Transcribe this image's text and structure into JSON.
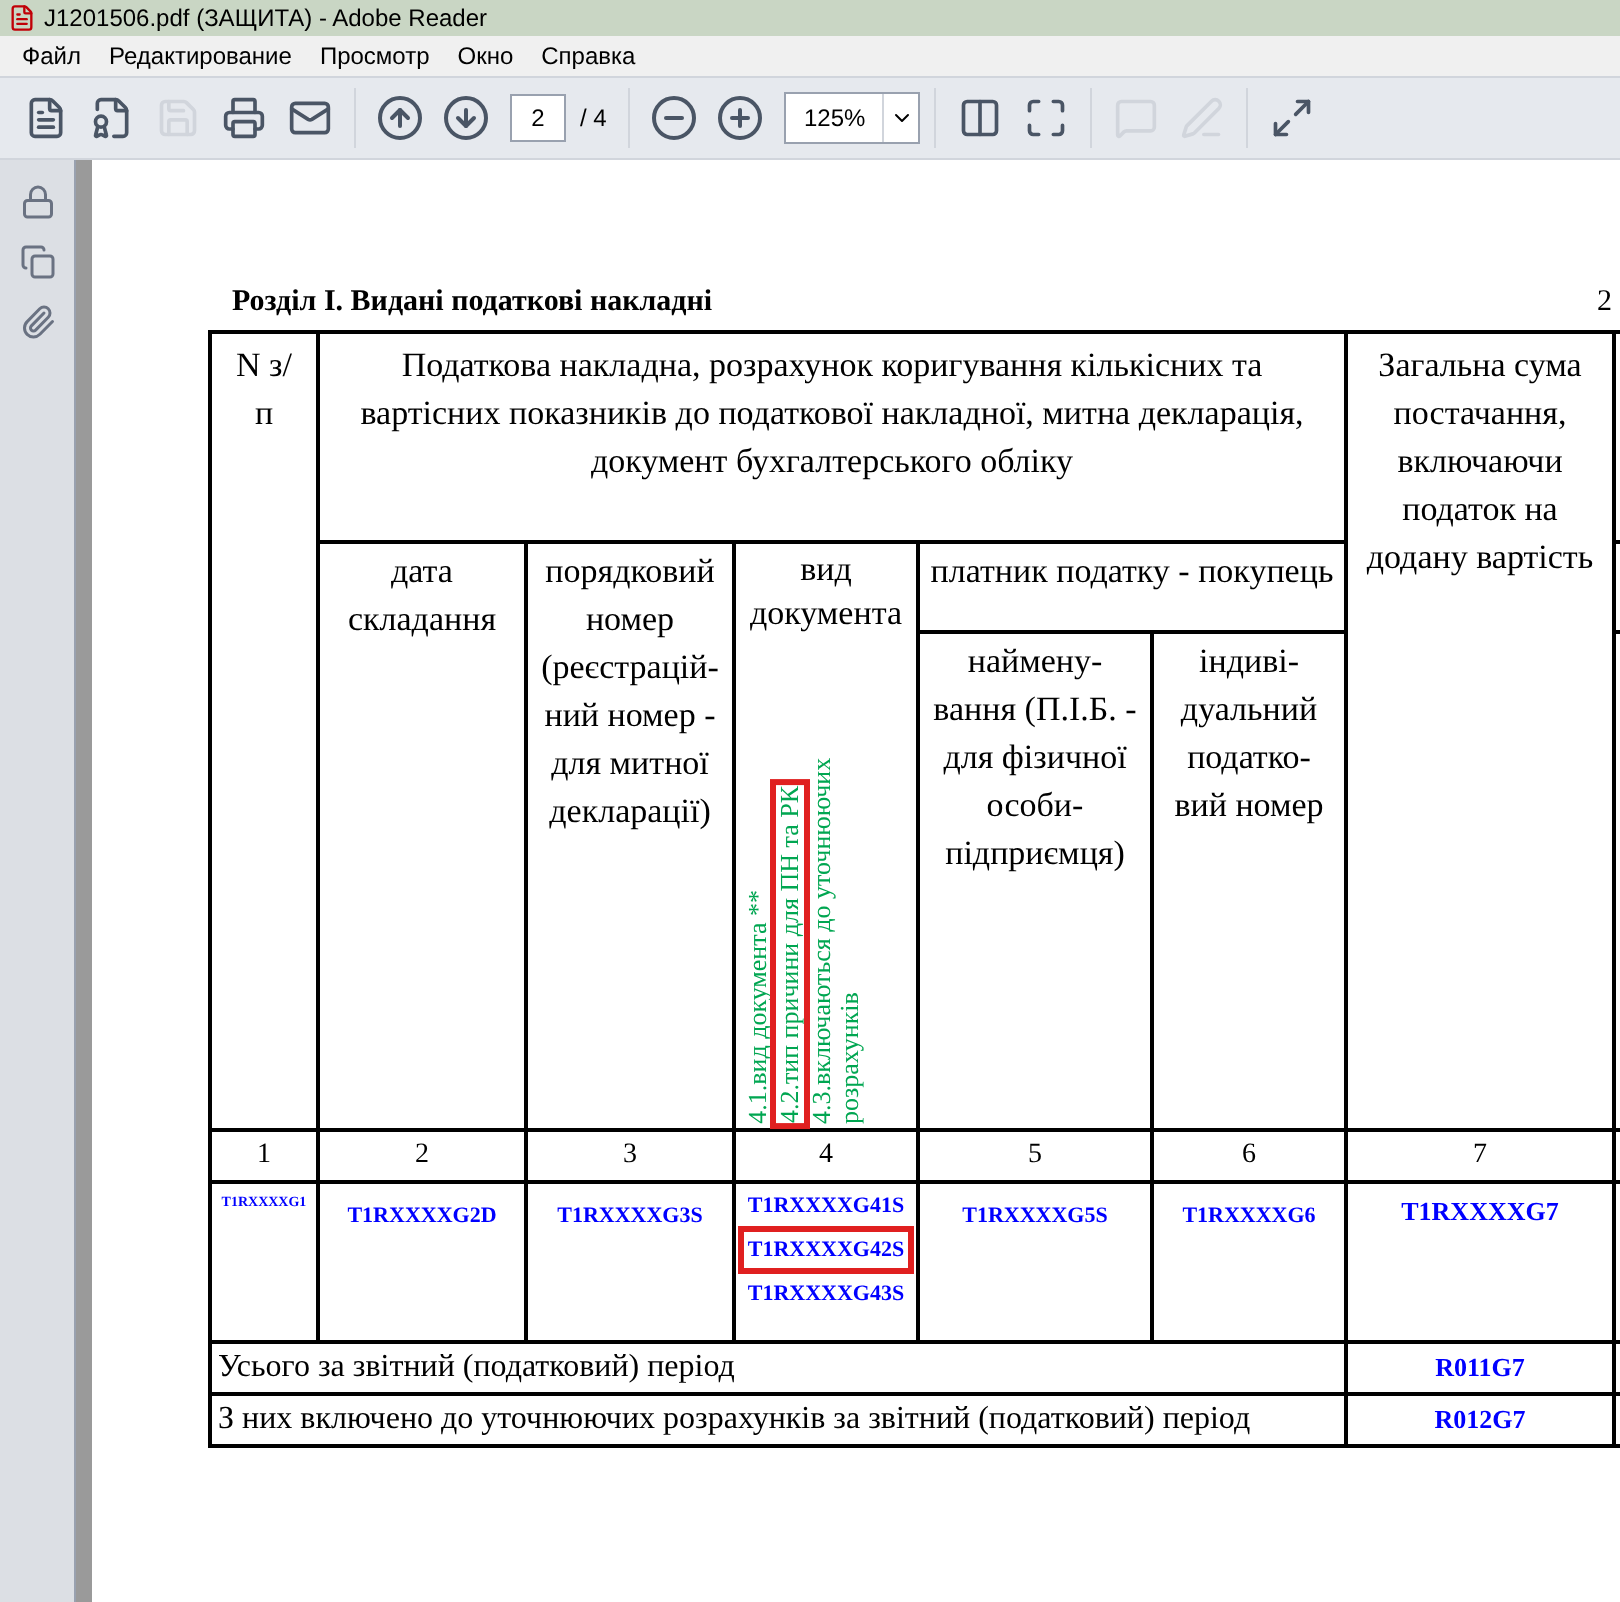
{
  "window": {
    "title": "J1201506.pdf (ЗАЩИТА) - Adobe Reader"
  },
  "menu": [
    "Файл",
    "Редактирование",
    "Просмотр",
    "Окно",
    "Справка"
  ],
  "toolbar": {
    "page_value": "2",
    "page_total": "/ 4",
    "zoom": "125%"
  },
  "page": {
    "page_number": "2",
    "section_title": "Розділ І. Видані податкові накладні",
    "header": {
      "number": "N з/п",
      "group": "Податкова накладна, розрахунок коригування кількісних та вартісних показників до податкової накладної, митна декларація, документ бухгалтерського обліку",
      "total": "Загальна сума постачання, включаючи податок на додану вартість",
      "date": "дата складання",
      "serial": "порядковий номер (реєстрацій-ний номер - для митної декларації)",
      "doc_type": "вид документа",
      "buyer": "платник податку - покупець",
      "buyer_name": "наймену-вання (П.І.Б. - для фізичної особи-підприємця)",
      "buyer_tax": "індиві-дуальний податко-вий номер",
      "doc_type_notes": [
        {
          "text": "4.1.вид документа  **",
          "highlighted": false
        },
        {
          "text": "4.2.тип причини для ПН та РК",
          "highlighted": true
        },
        {
          "text": "4.3.включаються до уточнюючих розрахунків",
          "highlighted": false
        }
      ]
    },
    "column_numbers": [
      "1",
      "2",
      "3",
      "4",
      "5",
      "6",
      "7"
    ],
    "fields": {
      "col1": "T1RXXXXG1",
      "col2": "T1RXXXXG2D",
      "col3": "T1RXXXXG3S",
      "col4": [
        {
          "text": "T1RXXXXG41S",
          "highlighted": false
        },
        {
          "text": "T1RXXXXG42S",
          "highlighted": true
        },
        {
          "text": "T1RXXXXG43S",
          "highlighted": false
        }
      ],
      "col5": "T1RXXXXG5S",
      "col6": "T1RXXXXG6",
      "col7": "T1RXXXXG7"
    },
    "totals": [
      {
        "label": "Усього за звітний (податковий) період",
        "value": "R011G7"
      },
      {
        "label": "З них включено до уточнюючих розрахунків за звітний (податковий) період",
        "value": "R012G7"
      }
    ]
  }
}
